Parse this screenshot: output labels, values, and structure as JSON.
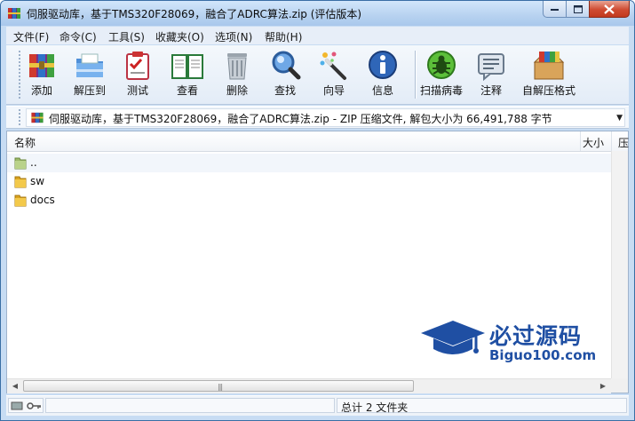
{
  "window": {
    "title": "伺服驱动库，基于TMS320F28069，融合了ADRC算法.zip (评估版本)"
  },
  "menu": [
    "文件(F)",
    "命令(C)",
    "工具(S)",
    "收藏夹(O)",
    "选项(N)",
    "帮助(H)"
  ],
  "toolbar": [
    {
      "label": "添加",
      "icon": "add-archive-icon"
    },
    {
      "label": "解压到",
      "icon": "extract-to-icon"
    },
    {
      "label": "测试",
      "icon": "test-icon"
    },
    {
      "label": "查看",
      "icon": "view-icon"
    },
    {
      "label": "删除",
      "icon": "delete-icon"
    },
    {
      "label": "查找",
      "icon": "find-icon"
    },
    {
      "label": "向导",
      "icon": "wizard-icon"
    },
    {
      "label": "信息",
      "icon": "info-icon"
    },
    {
      "label": "扫描病毒",
      "icon": "virus-scan-icon"
    },
    {
      "label": "注释",
      "icon": "comment-icon"
    },
    {
      "label": "自解压格式",
      "icon": "sfx-icon"
    }
  ],
  "address": {
    "path": "伺服驱动库，基于TMS320F28069，融合了ADRC算法.zip - ZIP 压缩文件, 解包大小为 66,491,788 字节"
  },
  "columns": {
    "name": "名称",
    "size": "大小",
    "extra": "压"
  },
  "files": [
    {
      "name": "..",
      "icon": "parent-folder-icon"
    },
    {
      "name": "sw",
      "icon": "folder-icon"
    },
    {
      "name": "docs",
      "icon": "folder-icon"
    }
  ],
  "status": {
    "text": "总计 2 文件夹"
  },
  "watermark": {
    "title": "必过源码",
    "subtitle": "Biguo100.com"
  },
  "colors": {
    "accent": "#3a6ea5",
    "watermark": "#1f4fa3",
    "close": "#cf4b31"
  }
}
